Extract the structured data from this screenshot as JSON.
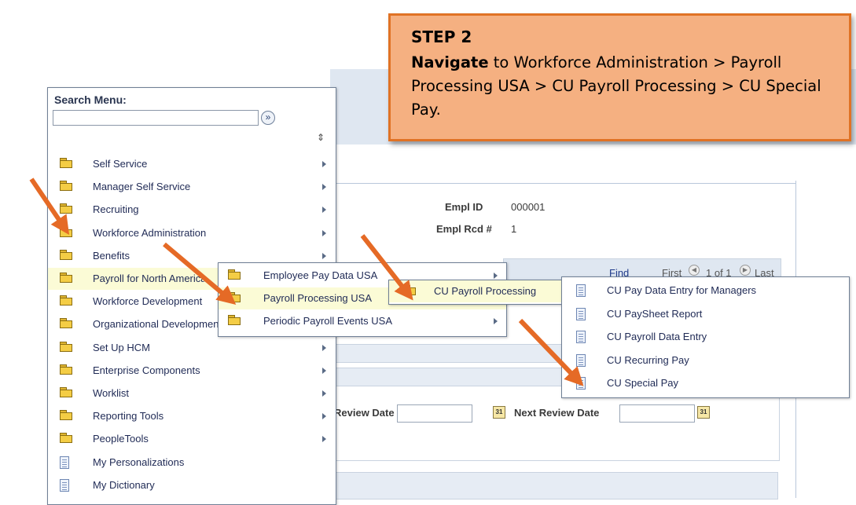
{
  "callout": {
    "step": "STEP 2",
    "bold": "Navigate",
    "rest": " to Workforce Administration > Payroll Processing USA > CU Payroll Processing > CU Special Pay."
  },
  "search_menu": {
    "label": "Search Menu:",
    "input_value": "",
    "go_icon": "»",
    "sort_icon": "⇕",
    "items": [
      {
        "label": "Self Service",
        "icon": "folder-icon",
        "arrow": true
      },
      {
        "label": "Manager Self Service",
        "icon": "folder-icon",
        "arrow": true
      },
      {
        "label": "Recruiting",
        "icon": "folder-icon",
        "arrow": true
      },
      {
        "label": "Workforce Administration",
        "icon": "folder-icon",
        "arrow": true
      },
      {
        "label": "Benefits",
        "icon": "folder-icon",
        "arrow": true
      },
      {
        "label": "Payroll for North America",
        "icon": "folder-icon",
        "arrow": true
      },
      {
        "label": "Workforce Development",
        "icon": "folder-icon",
        "arrow": true
      },
      {
        "label": "Organizational Development",
        "icon": "folder-icon",
        "arrow": true
      },
      {
        "label": "Set Up HCM",
        "icon": "folder-icon",
        "arrow": true
      },
      {
        "label": "Enterprise Components",
        "icon": "folder-icon",
        "arrow": true
      },
      {
        "label": "Worklist",
        "icon": "folder-icon",
        "arrow": true
      },
      {
        "label": "Reporting Tools",
        "icon": "folder-icon",
        "arrow": true
      },
      {
        "label": "PeopleTools",
        "icon": "folder-icon",
        "arrow": true
      },
      {
        "label": "My Personalizations",
        "icon": "document-icon",
        "arrow": false
      },
      {
        "label": "My Dictionary",
        "icon": "document-icon",
        "arrow": false
      }
    ]
  },
  "submenu_payroll": {
    "items": [
      {
        "label": "Employee Pay Data USA"
      },
      {
        "label": "Payroll Processing USA"
      },
      {
        "label": "Periodic Payroll Events USA"
      }
    ]
  },
  "submenu_processing": {
    "items": [
      {
        "label": "CU Payroll Processing"
      }
    ]
  },
  "submenu_cu": {
    "items": [
      {
        "label": "CU Pay Data Entry for Managers"
      },
      {
        "label": "CU PaySheet Report"
      },
      {
        "label": "CU Payroll Data Entry"
      },
      {
        "label": "CU Recurring Pay"
      },
      {
        "label": "CU Special Pay"
      }
    ]
  },
  "page": {
    "empl_id_label": "Empl ID",
    "empl_id_value": "000001",
    "empl_rcd_label": "Empl Rcd #",
    "empl_rcd_value": "1",
    "find": "Find",
    "first": "First",
    "count": "1 of 1",
    "last": "Last",
    "review_date_label": "Review Date",
    "next_review_date_label": "Next Review Date",
    "calendar_glyph": "31"
  },
  "colors": {
    "callout_fill": "#f5b081",
    "callout_border": "#e07224",
    "arrow": "#e56a26",
    "highlight": "#fbfbd6"
  }
}
